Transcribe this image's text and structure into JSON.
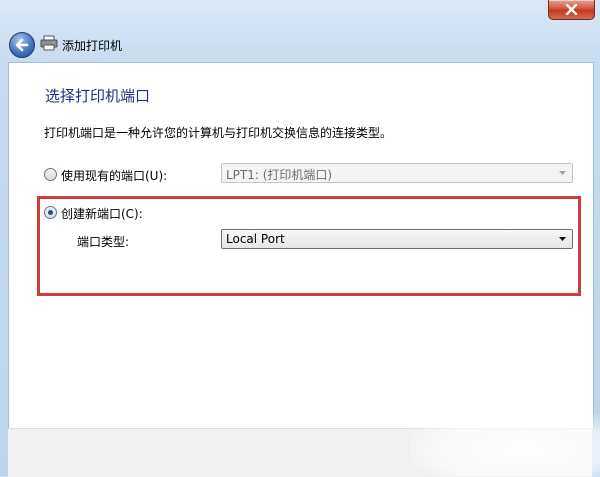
{
  "window": {
    "title": "添加打印机"
  },
  "content": {
    "heading": "选择打印机端口",
    "description": "打印机端口是一种允许您的计算机与打印机交换信息的连接类型。"
  },
  "options": {
    "use_existing": {
      "label": "使用现有的端口(U):",
      "selected": false,
      "value": "LPT1: (打印机端口)"
    },
    "create_new": {
      "label": "创建新端口(C):",
      "selected": true,
      "port_type_label": "端口类型:",
      "port_type_value": "Local Port"
    }
  },
  "colors": {
    "highlight_border": "#d23b3b",
    "heading": "#1e3287"
  }
}
